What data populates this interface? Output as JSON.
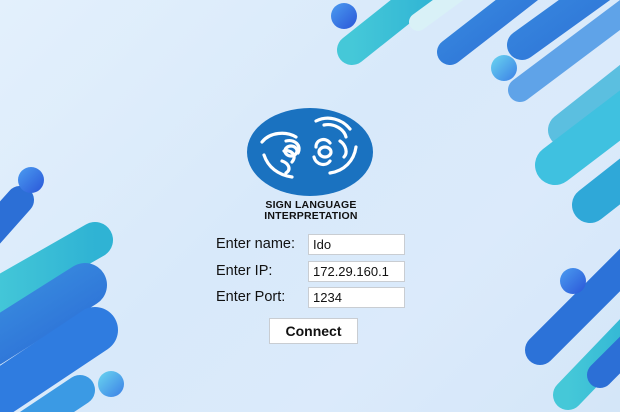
{
  "logo": {
    "icon": "sign-language-icon",
    "text_line1": "SIGN LANGUAGE",
    "text_line2": "INTERPRETATION"
  },
  "form": {
    "name_label": "Enter name:",
    "name_value": "Ido",
    "ip_label": "Enter IP:",
    "ip_value": "172.29.160.1",
    "port_label": "Enter Port:",
    "port_value": "1234",
    "connect_label": "Connect"
  },
  "colors": {
    "logo_blue": "#1a72c0",
    "accent_cyan": "#3fc6d9",
    "accent_blue": "#3a7fe0",
    "background": "#dfedfb"
  }
}
